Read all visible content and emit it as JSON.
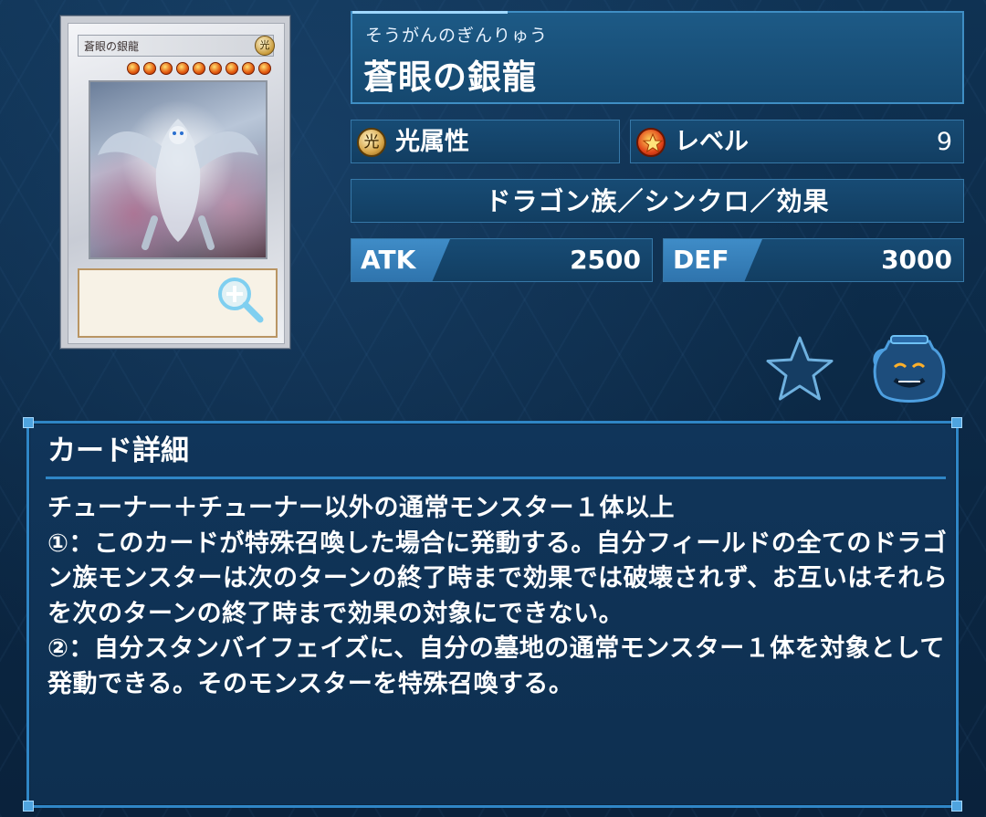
{
  "card": {
    "ruby": "そうがんのぎんりゅう",
    "name": "蒼眼の銀龍",
    "attribute": {
      "icon": "light-attribute-icon",
      "icon_glyph": "光",
      "label": "光属性"
    },
    "level": {
      "icon": "level-star-icon",
      "label": "レベル",
      "value": "9",
      "stars": 9
    },
    "type_line": "ドラゴン族／シンクロ／効果",
    "atk": {
      "label": "ATK",
      "value": "2500"
    },
    "def": {
      "label": "DEF",
      "value": "3000"
    }
  },
  "card_image": {
    "mini_name": "蒼眼の銀龍",
    "attribute_glyph": "光",
    "zoom_icon": "magnifier-zoom-icon"
  },
  "actions": {
    "favorite_icon": "star-icon",
    "deck_icon": "pot-of-greed-icon"
  },
  "detail": {
    "title": "カード詳細",
    "text": "チューナー＋チューナー以外の通常モンスター１体以上\n①：このカードが特殊召喚した場合に発動する。自分フィールドの全てのドラゴン族モンスターは次のターンの終了時まで効果では破壊されず、お互いはそれらを次のターンの終了時まで効果の対象にできない。\n②：自分スタンバイフェイズに、自分の墓地の通常モンスター１体を対象として発動できる。そのモンスターを特殊召喚する。"
  },
  "colors": {
    "background": "#0c2a45",
    "panel": "#15486f",
    "border": "#3f8ec4",
    "stat_tag": "#3f8cc7"
  }
}
